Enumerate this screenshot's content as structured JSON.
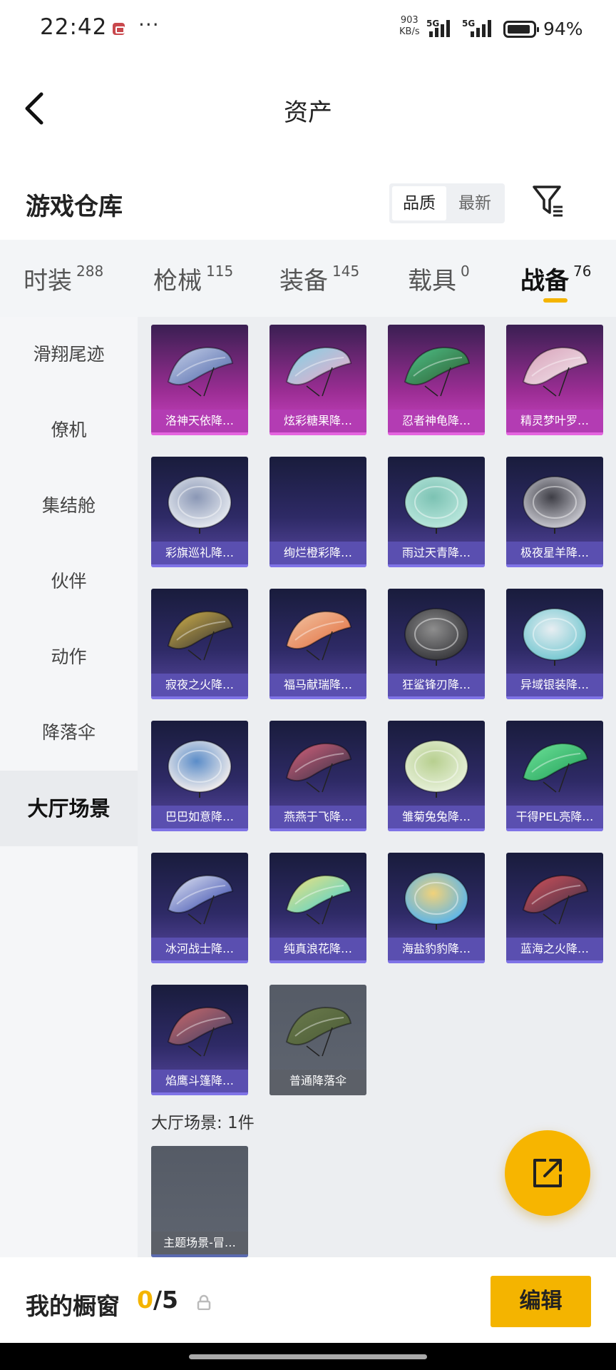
{
  "status_bar": {
    "time": "22:42",
    "more": "···",
    "net_speed": "903",
    "net_unit": "KB/s",
    "sim1": "5G",
    "sim2": "5G",
    "battery": "94%"
  },
  "header": {
    "title": "资产"
  },
  "repository": {
    "title": "游戏仓库",
    "sort_options": [
      "品质",
      "最新"
    ],
    "sort_selected": "品质"
  },
  "tabs": [
    {
      "label": "时装",
      "count": "288"
    },
    {
      "label": "枪械",
      "count": "115"
    },
    {
      "label": "装备",
      "count": "145"
    },
    {
      "label": "载具",
      "count": "0"
    },
    {
      "label": "战备",
      "count": "76"
    }
  ],
  "active_tab": "战备",
  "sidebar": {
    "items": [
      "滑翔尾迹",
      "僚机",
      "集结舱",
      "伙伴",
      "动作",
      "降落伞",
      "大厅场景"
    ],
    "active": "大厅场景"
  },
  "items": [
    {
      "label": "洛神天依降…",
      "rarity": "purple"
    },
    {
      "label": "炫彩糖果降…",
      "rarity": "purple"
    },
    {
      "label": "忍者神龟降…",
      "rarity": "purple"
    },
    {
      "label": "精灵梦叶罗…",
      "rarity": "purple"
    },
    {
      "label": "彩旗巡礼降…",
      "rarity": "blue"
    },
    {
      "label": "绚烂橙彩降…",
      "rarity": "blue"
    },
    {
      "label": "雨过天青降…",
      "rarity": "blue"
    },
    {
      "label": "极夜星羊降…",
      "rarity": "blue"
    },
    {
      "label": "寂夜之火降…",
      "rarity": "blue"
    },
    {
      "label": "福马献瑞降…",
      "rarity": "blue"
    },
    {
      "label": "狂鲨锋刃降…",
      "rarity": "blue"
    },
    {
      "label": "异域银装降…",
      "rarity": "blue"
    },
    {
      "label": "巴巴如意降…",
      "rarity": "blue"
    },
    {
      "label": "燕燕于飞降…",
      "rarity": "blue"
    },
    {
      "label": "雏菊兔兔降…",
      "rarity": "blue"
    },
    {
      "label": "干得PEL亮降…",
      "rarity": "blue"
    },
    {
      "label": "冰河战士降…",
      "rarity": "blue"
    },
    {
      "label": "纯真浪花降…",
      "rarity": "blue"
    },
    {
      "label": "海盐豹豹降…",
      "rarity": "blue"
    },
    {
      "label": "蓝海之火降…",
      "rarity": "blue"
    },
    {
      "label": "焰鹰斗篷降…",
      "rarity": "blue"
    },
    {
      "label": "普通降落伞",
      "rarity": "gray"
    }
  ],
  "lobby_section": {
    "label": "大厅场景: 1件",
    "items": [
      {
        "label": "主题场景-冒…",
        "rarity": "gray"
      }
    ]
  },
  "showcase": {
    "label": "我的橱窗",
    "current": "0",
    "separator": "/",
    "max": "5",
    "edit_label": "编辑"
  },
  "colors": {
    "accent": "#f4b400",
    "purple_rarity": "#b33cb3",
    "blue_rarity": "#5a4fb0"
  }
}
